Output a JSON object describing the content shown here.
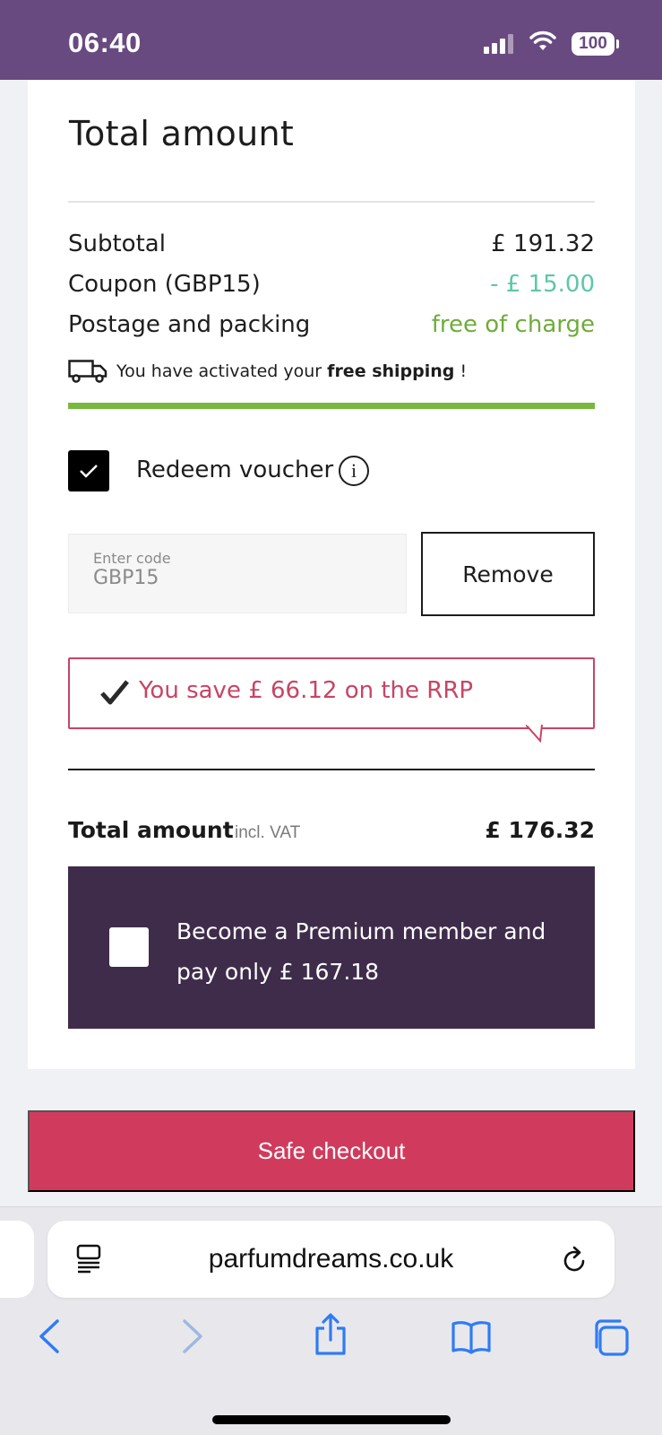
{
  "status_bar": {
    "time": "06:40",
    "battery": "100"
  },
  "summary": {
    "title": "Total amount",
    "subtotal_label": "Subtotal",
    "subtotal_value": "£ 191.32",
    "coupon_label": "Coupon (GBP15)",
    "coupon_value": "- £ 15.00",
    "postage_label": "Postage and packing",
    "postage_value": "free of charge",
    "shipping_prefix": "You have activated your",
    "shipping_bold": "free shipping",
    "shipping_suffix": "!",
    "shipping_progress": 1.0
  },
  "voucher": {
    "checked": true,
    "label": "Redeem voucher",
    "info_icon": "info-icon",
    "input_placeholder": "Enter code",
    "input_value": "GBP15",
    "remove_label": "Remove"
  },
  "savings": {
    "text": "You save £ 66.12 on the RRP"
  },
  "total": {
    "label": "Total amount",
    "vat_note": "incl. VAT",
    "value": "£ 176.32"
  },
  "premium": {
    "checked": false,
    "text": "Become a Premium member and pay only £ 167.18"
  },
  "checkout": {
    "label": "Safe checkout"
  },
  "browser": {
    "url": "parfumdreams.co.uk"
  },
  "colors": {
    "brand_purple": "#684a80",
    "premium_bg": "#3f2c4b",
    "checkout_red": "#d03b5d",
    "savings_pink": "#c84465",
    "coupon_teal": "#5cc7a8",
    "free_green": "#6fac3c"
  }
}
